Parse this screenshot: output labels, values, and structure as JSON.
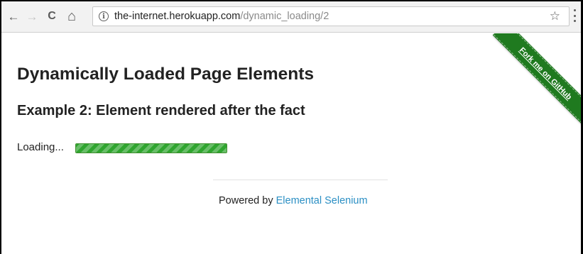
{
  "browser": {
    "url_host": "the-internet.herokuapp.com",
    "url_path": "/dynamic_loading/2",
    "back_icon": "←",
    "forward_icon": "→",
    "reload_icon": "C",
    "home_icon": "⌂",
    "info_icon": "i",
    "star_icon": "☆"
  },
  "page": {
    "heading": "Dynamically Loaded Page Elements",
    "subheading": "Example 2: Element rendered after the fact",
    "loading_text": "Loading...",
    "loading_progress": 1.0,
    "footer_prefix": "Powered by ",
    "footer_link": "Elemental Selenium",
    "ribbon_text": "Fork me on GitHub"
  },
  "colors": {
    "progress": "#2fa52f",
    "link": "#2b8fc4",
    "ribbon": "#1f7a1f"
  }
}
